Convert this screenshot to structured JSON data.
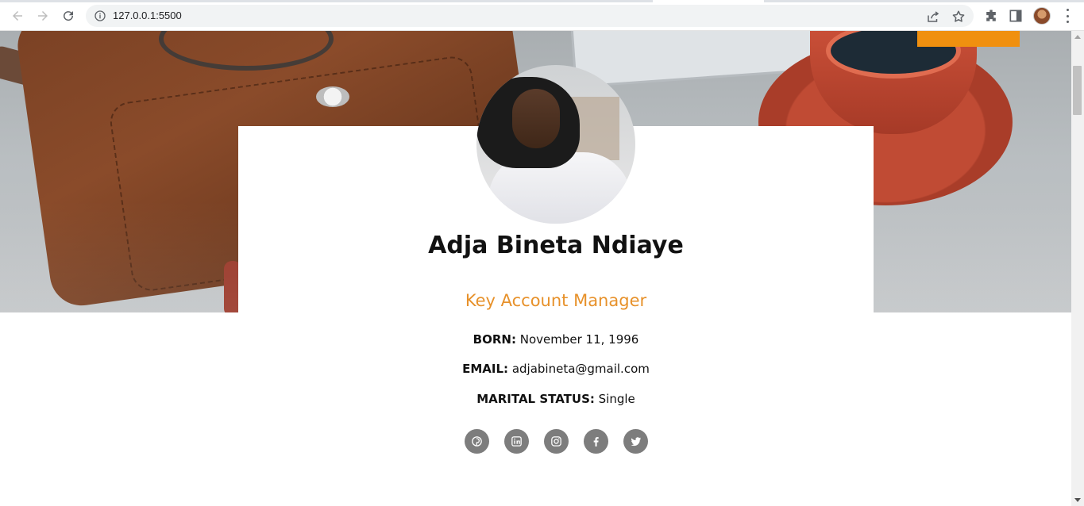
{
  "browser": {
    "url": "127.0.0.1:5500",
    "icons": [
      "back-icon",
      "forward-icon",
      "reload-icon",
      "site-info-icon",
      "share-icon",
      "bookmark-star-icon",
      "extensions-icon",
      "side-panel-icon",
      "profile-avatar",
      "menu-icon"
    ]
  },
  "profile": {
    "name": "Adja Bineta Ndiaye",
    "role": "Key Account Manager",
    "born_label": "BORN:",
    "born_value": "November 11, 1996",
    "email_label": "EMAIL:",
    "email_value": "adjabineta@gmail.com",
    "marital_label": "MARITAL STATUS:",
    "marital_value": "Single"
  },
  "socials": [
    "pinterest-icon",
    "linkedin-icon",
    "instagram-icon",
    "facebook-icon",
    "twitter-icon"
  ],
  "colors": {
    "accent": "#e7912a",
    "orange_button": "#f0900f",
    "social_icon_bg": "#7d7d7d"
  }
}
